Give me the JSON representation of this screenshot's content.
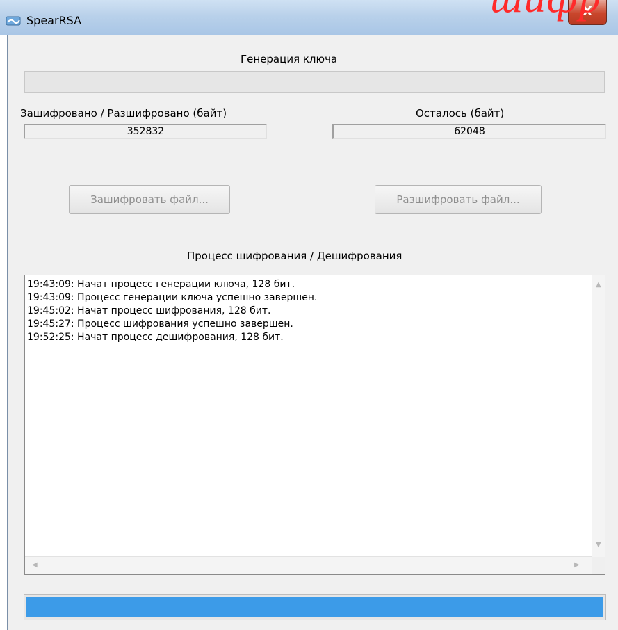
{
  "window": {
    "title": "SpearRSA",
    "close_label": "X",
    "overlay_text": "шифр",
    "app_icon": "spearrsa-app-icon"
  },
  "key_generation": {
    "label": "Генерация ключа",
    "progress": 0
  },
  "counters": {
    "processed_label": "Зашифровано / Разшифровано (байт)",
    "processed_value": "352832",
    "remaining_label": "Осталось (байт)",
    "remaining_value": "62048"
  },
  "buttons": {
    "encrypt": "Зашифровать файл...",
    "decrypt": "Разшифровать файл..."
  },
  "log": {
    "label": "Процесс шифрования / Дешифрования",
    "lines": [
      "19:43:09: Начат процесс генерации ключа, 128 бит.",
      "19:43:09: Процесс генерации ключа успешно завершен.",
      "19:45:02: Начат процесс шифрования, 128 бит.",
      "19:45:27: Процесс шифрования успешно завершен.",
      "19:52:25: Начат процесс дешифрования, 128 бит."
    ]
  },
  "progress": {
    "fraction": 1.0,
    "color": "#3c9be8"
  },
  "colors": {
    "titlebar": "#b9d1ea",
    "close_button": "#c9462c",
    "overlay_text": "#ff2a2a",
    "window_bg": "#f0f0f0"
  }
}
